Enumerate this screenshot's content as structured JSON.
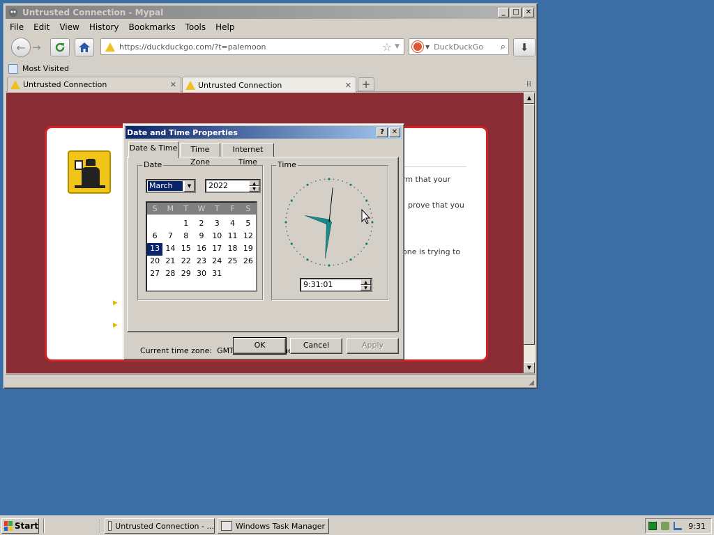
{
  "browser": {
    "title": "Untrusted Connection - Mypal",
    "menu": [
      "File",
      "Edit",
      "View",
      "History",
      "Bookmarks",
      "Tools",
      "Help"
    ],
    "url": "https://duckduckgo.com/?t=palemoon",
    "search_placeholder": "DuckDuckGo",
    "bookmark": "Most Visited",
    "tabs": [
      {
        "label": "Untrusted Connection",
        "active": false
      },
      {
        "label": "Untrusted Connection",
        "active": true
      }
    ]
  },
  "error_page": {
    "fragments": [
      "rm that your",
      "prove that you",
      "one is trying to"
    ],
    "accent_color": "#d62222",
    "background_color": "#8a2c33"
  },
  "dialog": {
    "title": "Date and Time Properties",
    "tabs": [
      "Date & Time",
      "Time Zone",
      "Internet Time"
    ],
    "date_group": "Date",
    "time_group": "Time",
    "month": "March",
    "year": "2022",
    "weekdays": [
      "S",
      "M",
      "T",
      "W",
      "T",
      "F",
      "S"
    ],
    "weeks": [
      [
        "",
        "",
        "1",
        "2",
        "3",
        "4",
        "5"
      ],
      [
        "6",
        "7",
        "8",
        "9",
        "10",
        "11",
        "12"
      ],
      [
        "13",
        "14",
        "15",
        "16",
        "17",
        "18",
        "19"
      ],
      [
        "20",
        "21",
        "22",
        "23",
        "24",
        "25",
        "26"
      ],
      [
        "27",
        "28",
        "29",
        "30",
        "31",
        "",
        ""
      ]
    ],
    "selected_day": "13",
    "time": "9:31:01",
    "clock": {
      "hours": 9,
      "minutes": 31,
      "seconds": 1
    },
    "timezone_label": "Current time zone:",
    "timezone_value": "GMT Standard Time",
    "buttons": {
      "ok": "OK",
      "cancel": "Cancel",
      "apply": "Apply"
    }
  },
  "taskbar": {
    "start": "Start",
    "tasks": [
      "Untrusted Connection - ...",
      "Windows Task Manager"
    ],
    "clock": "9:31"
  }
}
